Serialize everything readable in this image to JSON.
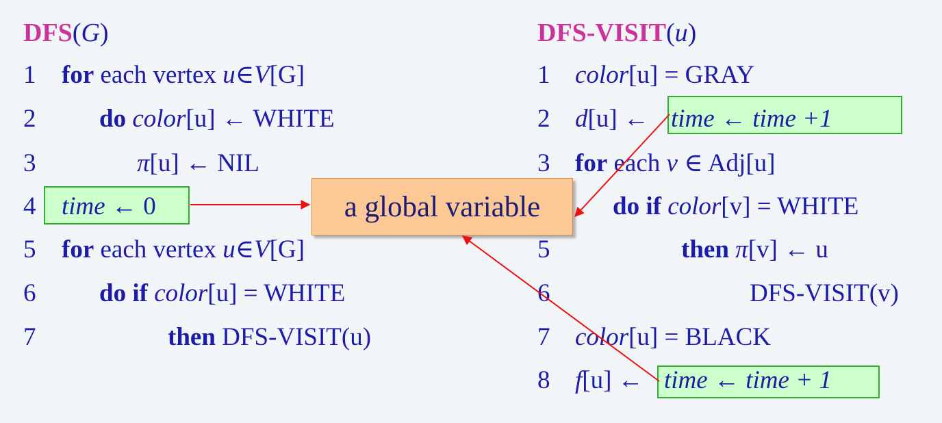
{
  "left": {
    "title": {
      "name": "DFS",
      "open": "(",
      "arg": "G",
      "close": ")"
    },
    "lines": [
      {
        "num": "1",
        "kw": "for",
        "text": " each vertex ",
        "var": "u",
        "op": "∈",
        "set": "V",
        "rest": "[G]"
      },
      {
        "num": "2",
        "kw": "do",
        "var": "color",
        "rest": "[u] ← WHITE"
      },
      {
        "num": "3",
        "var": "π",
        "rest": "[u] ← NIL"
      },
      {
        "num": "4",
        "var": "time",
        "rest": " ← 0"
      },
      {
        "num": "5",
        "kw": "for",
        "text": " each vertex ",
        "var": "u",
        "op": "∈",
        "set": "V",
        "rest": "[G]"
      },
      {
        "num": "6",
        "kw": "do if",
        "var": "color",
        "rest": "[u] = WHITE"
      },
      {
        "num": "7",
        "kw": "then",
        "rest": " DFS-VISIT(u)"
      }
    ]
  },
  "right": {
    "title": {
      "name": "DFS-VISIT",
      "open": "(",
      "arg": "u",
      "close": ")"
    },
    "lines": [
      {
        "num": "1",
        "var": "color",
        "rest": "[u] = GRAY"
      },
      {
        "num": "2",
        "var": "d",
        "rest": "[u] ←",
        "boxed": "time ← time +1"
      },
      {
        "num": "3",
        "kw": "for",
        "text": " each ",
        "var": "v",
        "rest": " ∈ Adj[u]"
      },
      {
        "num": "",
        "kw": "do if",
        "var": "color",
        "rest": "[v] = WHITE"
      },
      {
        "num": "5",
        "kw": "then",
        "var": "π",
        "rest": "[v] ← u"
      },
      {
        "num": "6",
        "rest": "DFS-VISIT(v)"
      },
      {
        "num": "7",
        "var": "color",
        "rest": "[u] = BLACK"
      },
      {
        "num": "8",
        "var": "f",
        "rest": "[u] ←",
        "boxed": "time ← time + 1"
      }
    ]
  },
  "callout": {
    "label": "a global variable"
  },
  "colors": {
    "title": "#cc3399",
    "code": "#1c1ca8",
    "box_fill": "#ccffcc",
    "box_border": "#33aa33",
    "callout_fill": "#fbc896",
    "arrow": "#ee1111"
  }
}
